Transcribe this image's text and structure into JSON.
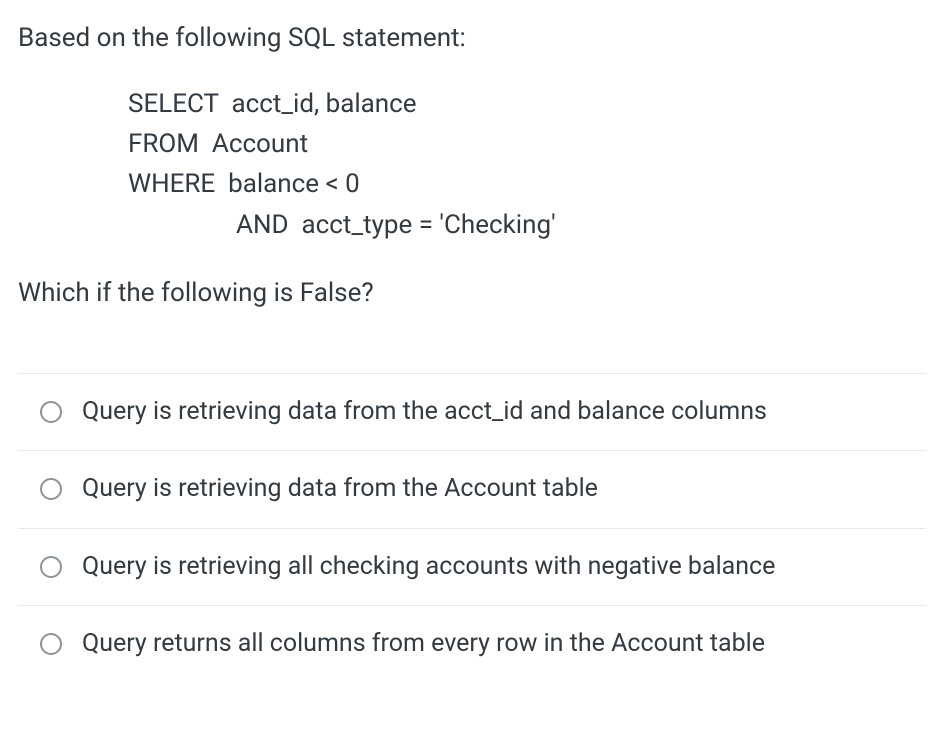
{
  "question": {
    "intro": "Based on the following SQL statement:",
    "sql": {
      "line1": "SELECT  acct_id, balance",
      "line2": "FROM  Account",
      "line3": "WHERE  balance < 0",
      "line4": "AND  acct_type = 'Checking'"
    },
    "prompt": "Which if the following is False?"
  },
  "options": [
    {
      "label": "Query is retrieving data from the acct_id and balance columns"
    },
    {
      "label": "Query is retrieving data from the Account table"
    },
    {
      "label": "Query is retrieving all checking accounts with negative balance"
    },
    {
      "label": "Query returns all columns from every row in the Account table"
    }
  ]
}
